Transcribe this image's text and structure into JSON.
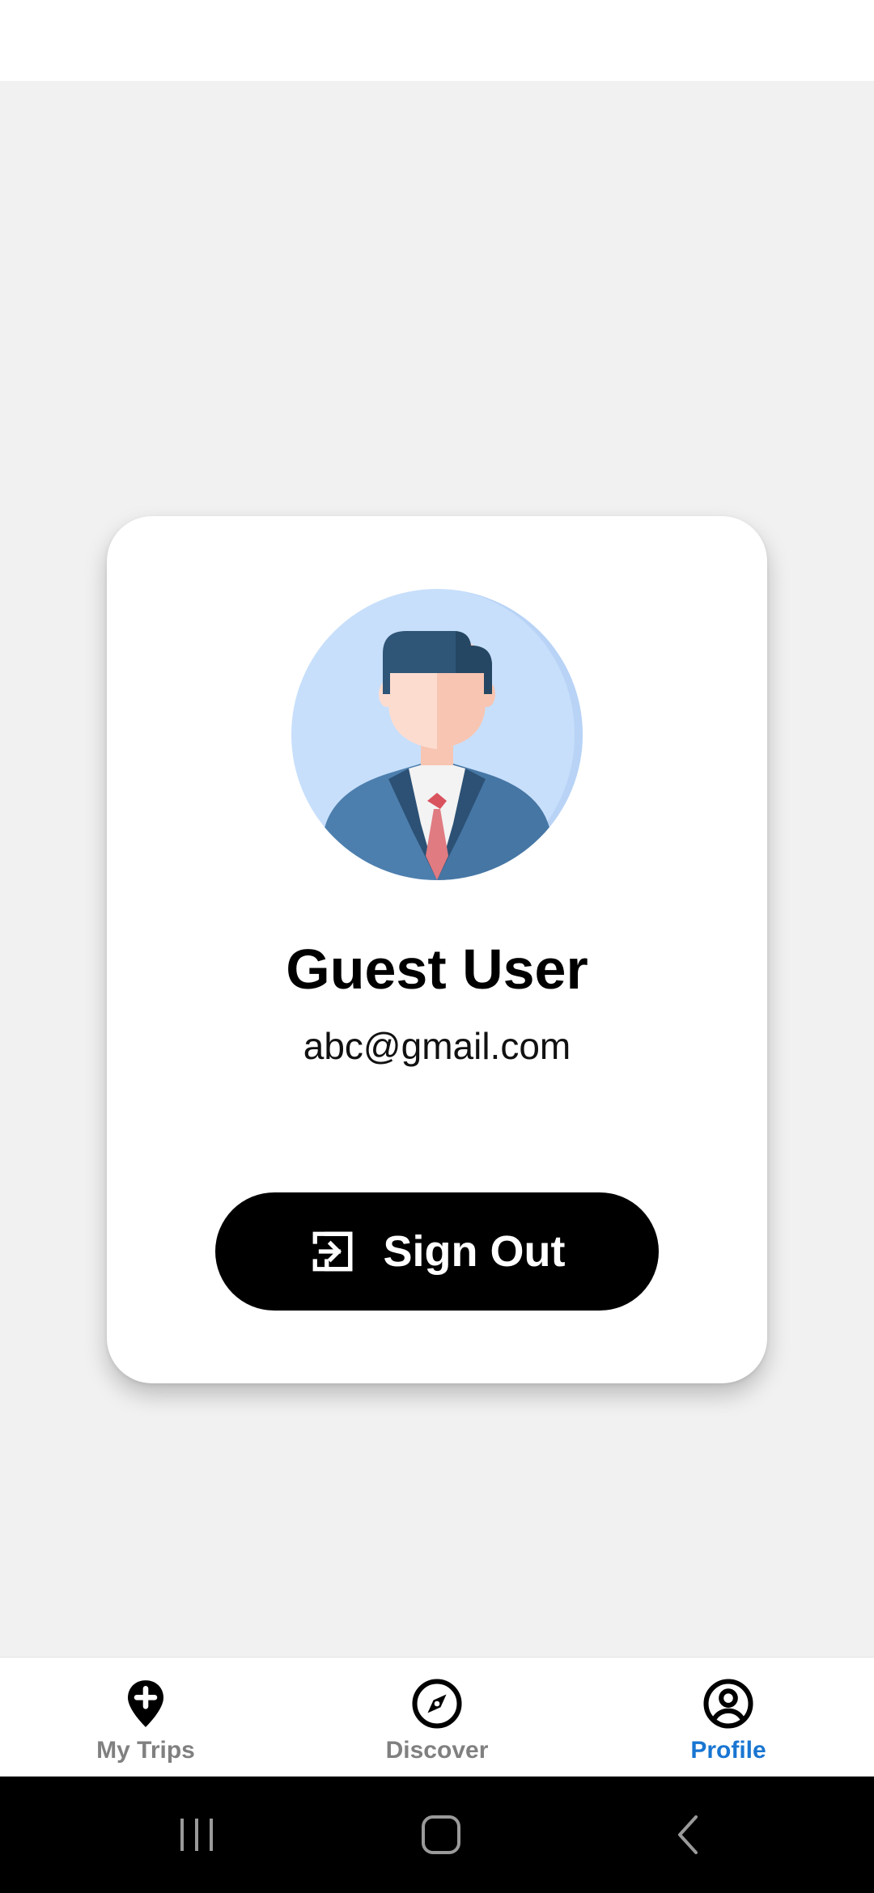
{
  "profile": {
    "name": "Guest User",
    "email": "abc@gmail.com",
    "avatar_icon": "businessman-avatar-icon"
  },
  "actions": {
    "sign_out_label": "Sign Out",
    "sign_out_icon": "sign-out-icon"
  },
  "bottom_nav": {
    "items": [
      {
        "label": "My Trips",
        "icon": "map-pin-add-icon",
        "active": false
      },
      {
        "label": "Discover",
        "icon": "compass-icon",
        "active": false
      },
      {
        "label": "Profile",
        "icon": "account-circle-icon",
        "active": true
      }
    ],
    "active_color": "#1976d2",
    "inactive_color": "#808080"
  },
  "system_nav": {
    "buttons": [
      "recent-apps-icon",
      "home-icon",
      "back-icon"
    ]
  }
}
